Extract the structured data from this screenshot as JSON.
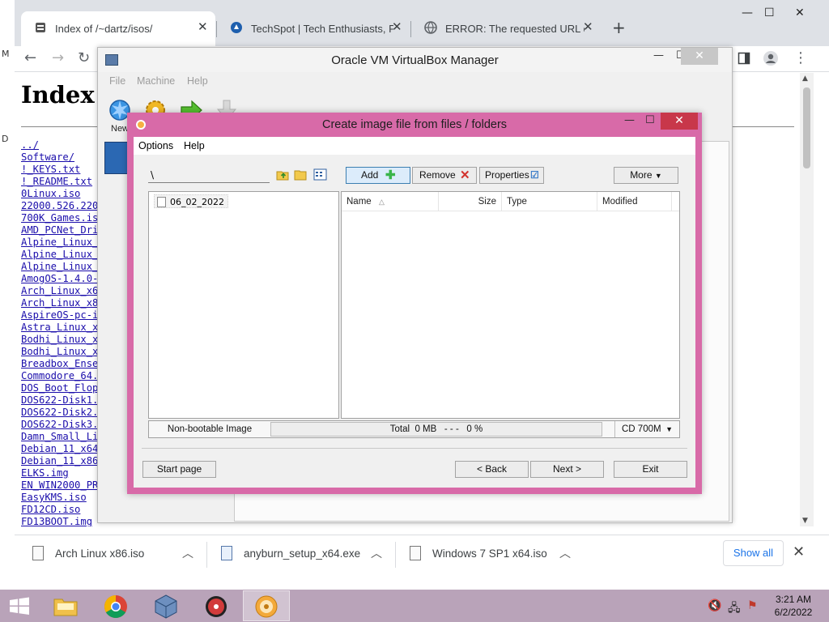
{
  "browser": {
    "tabs": [
      {
        "title": "Index of /~dartz/isos/",
        "active": true
      },
      {
        "title": "TechSpot | Tech Enthusiasts, Pow"
      },
      {
        "title": "ERROR: The requested URL could"
      }
    ],
    "page": {
      "title": "Index o",
      "files": [
        "../",
        "Software/",
        "!_KEYS.txt",
        "!_README.txt",
        "0Linux.iso",
        "22000.526.220",
        "700K_Games.is",
        "AMD_PCNet_Dri",
        "Alpine_Linux_",
        "Alpine_Linux_",
        "Alpine_Linux_",
        "AmogOS-1.4.0-",
        "Arch_Linux_x6",
        "Arch_Linux_x8",
        "AspireOS-pc-i",
        "Astra_Linux_x",
        "Bodhi_Linux_x",
        "Bodhi_Linux_x",
        "Breadbox_Ense",
        "Commodore_64.",
        "DOS_Boot_Flop",
        "DOS622-Disk1.",
        "DOS622-Disk2.",
        "DOS622-Disk3.",
        "Damn_Small_Li",
        "Debian_11_x64",
        "Debian_11_x86",
        "ELKS.img",
        "EN_WIN2000_PR",
        "EasyKMS.iso",
        "FD12CD.iso",
        "FD13BOOT.img"
      ]
    },
    "downloads": [
      {
        "name": "Arch Linux x86.iso"
      },
      {
        "name": "anyburn_setup_x64.exe"
      },
      {
        "name": "Windows 7 SP1 x64.iso"
      }
    ],
    "show_all_label": "Show all"
  },
  "vbox": {
    "title": "Oracle VM VirtualBox Manager",
    "menu": [
      "File",
      "Machine",
      "Help"
    ],
    "new_label": "New"
  },
  "dialog": {
    "title": "Create image file from files / folders",
    "menu": [
      "Options",
      "Help"
    ],
    "path_value": "\\",
    "buttons": {
      "add": "Add",
      "remove": "Remove",
      "properties": "Properties",
      "more": "More"
    },
    "tree_item": "06_02_2022",
    "columns": [
      "Name",
      "Size",
      "Type",
      "Modified"
    ],
    "status": {
      "image_type": "Non-bootable Image",
      "total_label": "Total",
      "total_value": "0 MB",
      "separator": "- - -",
      "percent": "0 %",
      "progress_fraction": 0,
      "media": "CD 700M"
    },
    "footer": {
      "start_page": "Start page",
      "back": "< Back",
      "next": "Next >",
      "exit": "Exit"
    }
  },
  "taskbar": {
    "time": "3:21 AM",
    "date": "6/2/2022"
  },
  "colors": {
    "dialog_frame": "#d86aa8",
    "taskbar": "#b9a3b9",
    "link": "#1a0dab",
    "close_red": "#c8374a"
  }
}
